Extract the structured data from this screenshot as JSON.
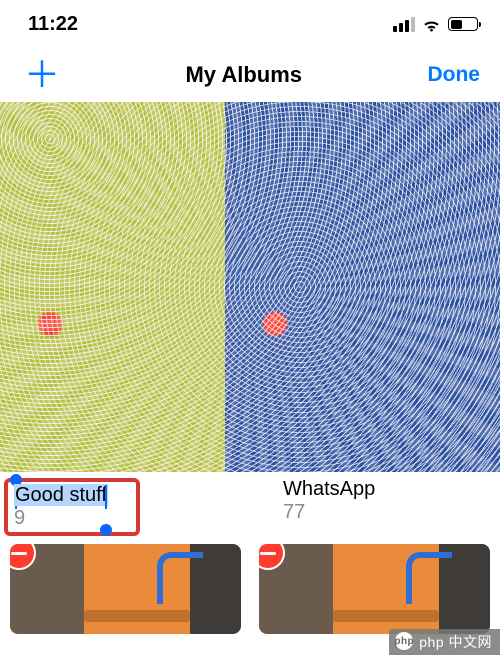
{
  "status": {
    "time": "11:22"
  },
  "nav": {
    "add_label": "＋",
    "title": "My Albums",
    "done_label": "Done"
  },
  "albums": [
    {
      "name": "Good stuff",
      "count": "9",
      "editing": true
    },
    {
      "name": "WhatsApp",
      "count": "77"
    }
  ],
  "watermark": {
    "text": "php 中文网",
    "logo": "php"
  }
}
